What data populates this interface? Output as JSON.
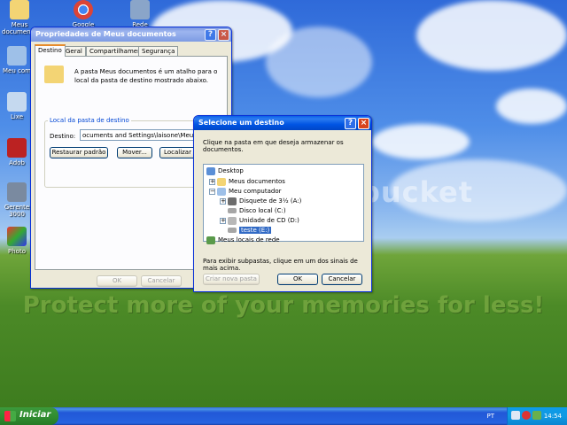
{
  "desktop": {
    "icons": [
      {
        "label": "Meus documentos",
        "icon": "folder-icon"
      },
      {
        "label": "Google Chrome",
        "icon": "chrome-icon"
      },
      {
        "label": "Rede",
        "icon": "network-icon"
      },
      {
        "label": "Meu com",
        "icon": "computer-icon"
      },
      {
        "label": "Lixe",
        "icon": "recycle-bin-icon"
      },
      {
        "label": "Adob",
        "icon": "adobe-icon"
      },
      {
        "label": "Gerente 3000",
        "icon": "app-icon"
      },
      {
        "label": "Photo",
        "icon": "photo-icon"
      }
    ],
    "watermark": "photobucket",
    "banner": "Protect more of your memories for less!"
  },
  "props_window": {
    "title": "Propriedades de Meus documentos",
    "tabs": [
      "Destino",
      "Geral",
      "Compartilhamento",
      "Segurança"
    ],
    "description": "A pasta Meus documentos é um atalho para o local da pasta de destino mostrado abaixo.",
    "group_label": "Local da pasta de destino",
    "dest_label": "Destino:",
    "dest_value": "ocuments and Settings\\laisone\\Meus docu",
    "btn_restore": "Restaurar padrão",
    "btn_move": "Mover...",
    "btn_find": "Localizar de",
    "btn_ok": "OK",
    "btn_cancel": "Cancelar"
  },
  "dest_dialog": {
    "title": "Selecione um destino",
    "instruction": "Clique na pasta em que deseja armazenar os documentos.",
    "tree": [
      {
        "label": "Desktop",
        "icon": "desktop-icon",
        "level": 0,
        "expander": ""
      },
      {
        "label": "Meus documentos",
        "icon": "folder-icon",
        "level": 1,
        "expander": "+"
      },
      {
        "label": "Meu computador",
        "icon": "computer-icon",
        "level": 1,
        "expander": "−"
      },
      {
        "label": "Disquete de 3½ (A:)",
        "icon": "floppy-icon",
        "level": 2,
        "expander": "+"
      },
      {
        "label": "Disco local (C:)",
        "icon": "drive-icon",
        "level": 2,
        "expander": ""
      },
      {
        "label": "Unidade de CD (D:)",
        "icon": "cd-drive-icon",
        "level": 2,
        "expander": "+"
      },
      {
        "label": "teste (E:)",
        "icon": "drive-icon",
        "level": 2,
        "expander": "",
        "selected": true
      },
      {
        "label": "Meus locais de rede",
        "icon": "network-places-icon",
        "level": 1,
        "expander": "+"
      }
    ],
    "hint": "Para exibir subpastas, clique em um dos sinais de mais acima.",
    "btn_new": "Criar nova pasta",
    "btn_ok": "OK",
    "btn_cancel": "Cancelar"
  },
  "taskbar": {
    "start": "Iniciar",
    "lang": "PT",
    "clock": "14:54"
  },
  "colors": {
    "title_active": "#0054e3",
    "selection": "#316ac5",
    "start_green": "#2f8a2f"
  }
}
